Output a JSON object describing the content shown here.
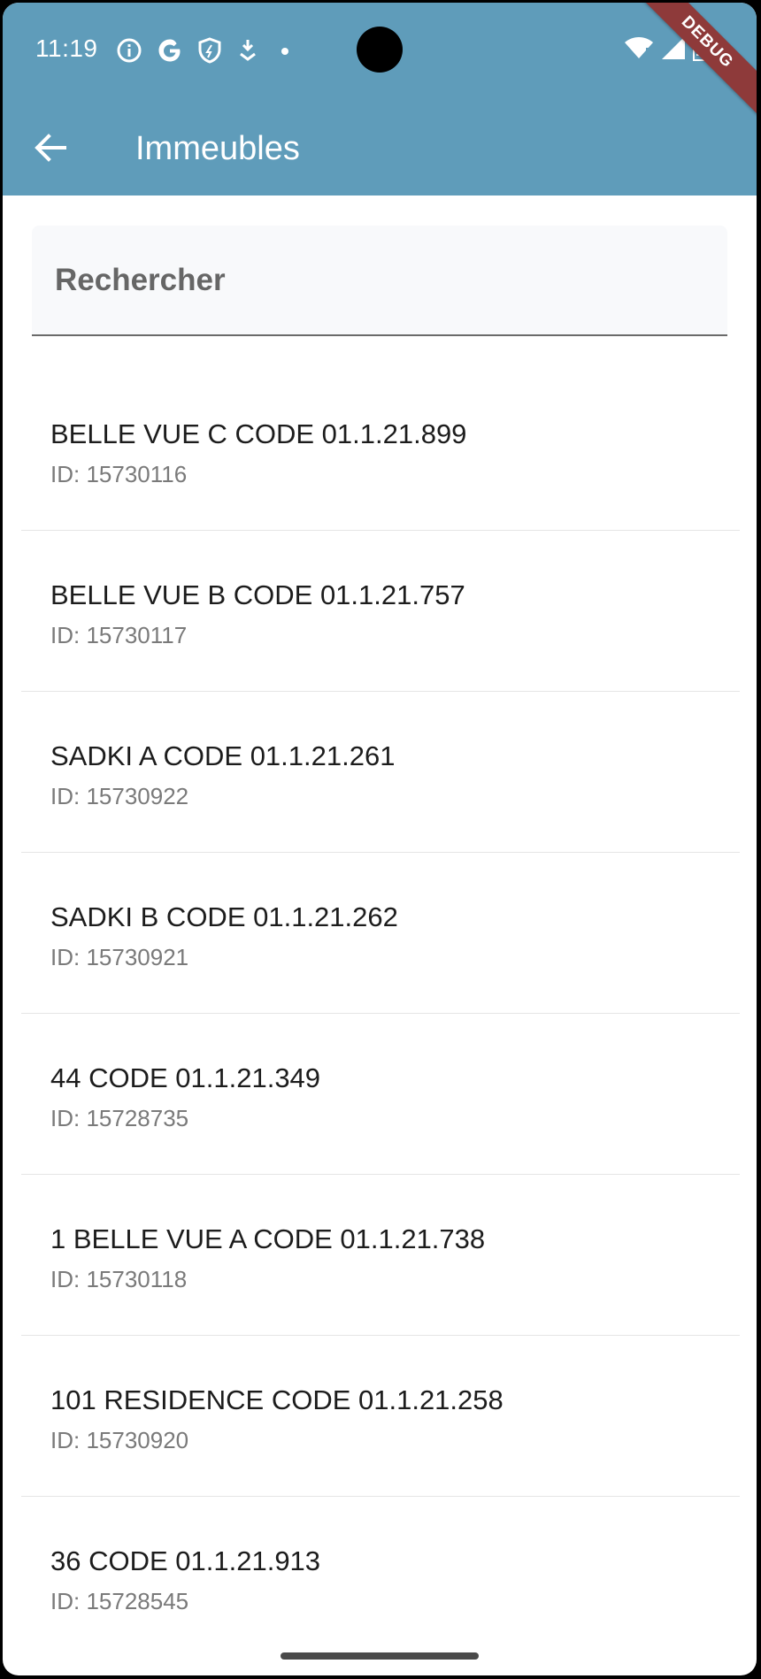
{
  "status_bar": {
    "time": "11:19",
    "left_icons": [
      "info-icon",
      "google-icon",
      "shield-icon",
      "download-icon",
      "dot-icon"
    ],
    "right_icons": [
      "wifi-icon",
      "signal-icon",
      "battery-icon"
    ]
  },
  "debug_banner": "DEBUG",
  "toolbar": {
    "title": "Immeubles",
    "back_icon": "arrow-left-icon"
  },
  "search": {
    "placeholder": "Rechercher",
    "value": ""
  },
  "buildings": [
    {
      "name": "BELLE VUE C CODE 01.1.21.899",
      "id": "ID: 15730116"
    },
    {
      "name": "BELLE VUE B CODE 01.1.21.757",
      "id": "ID: 15730117"
    },
    {
      "name": "SADKI A CODE 01.1.21.261",
      "id": "ID: 15730922"
    },
    {
      "name": "SADKI B CODE 01.1.21.262",
      "id": "ID: 15730921"
    },
    {
      "name": "44 CODE 01.1.21.349",
      "id": "ID: 15728735"
    },
    {
      "name": "1 BELLE VUE A CODE 01.1.21.738",
      "id": "ID: 15730118"
    },
    {
      "name": "101 RESIDENCE CODE 01.1.21.258",
      "id": "ID: 15730920"
    },
    {
      "name": "36 CODE 01.1.21.913",
      "id": "ID: 15728545"
    }
  ],
  "colors": {
    "app_bar": "#5f9cba",
    "debug_banner": "#8e3a3a",
    "background": "#ffffff"
  }
}
